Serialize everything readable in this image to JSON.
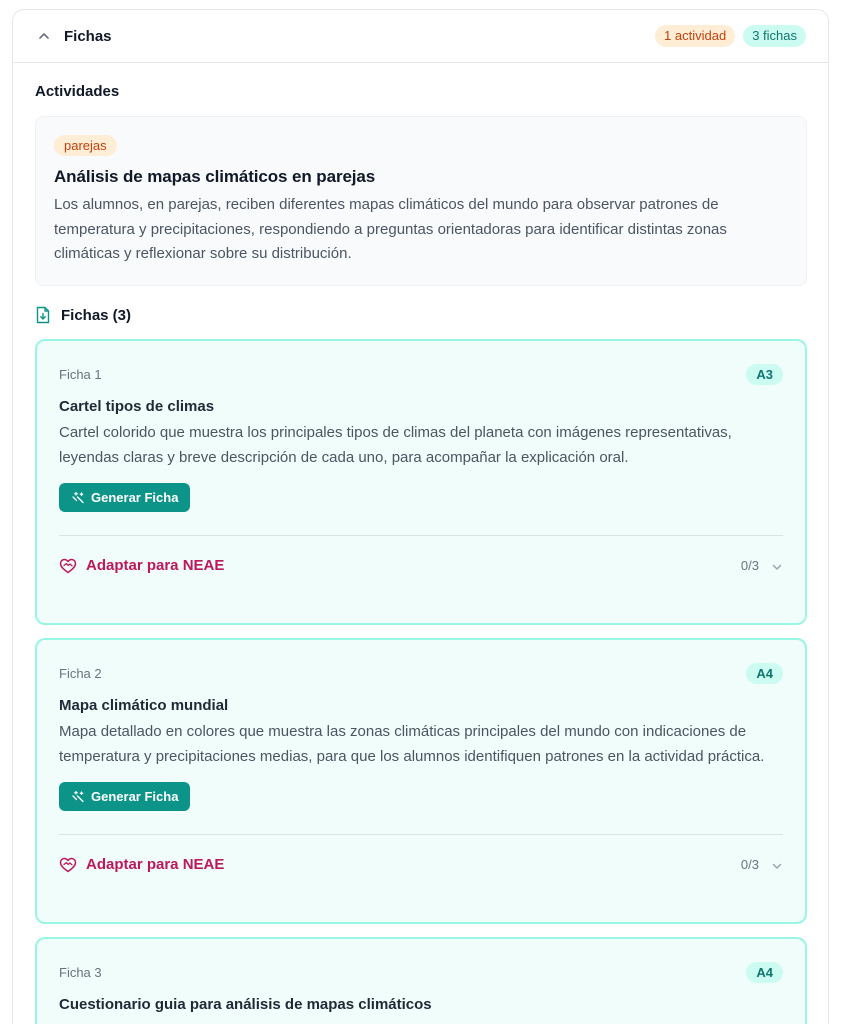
{
  "header": {
    "title": "Fichas",
    "activities_badge": "1 actividad",
    "fichas_badge": "3 fichas"
  },
  "activities": {
    "section_title": "Actividades",
    "items": [
      {
        "tag": "parejas",
        "title": "Análisis de mapas climáticos en parejas",
        "description": "Los alumnos, en parejas, reciben diferentes mapas climáticos del mundo para observar patrones de temperatura y precipitaciones, respondiendo a preguntas orientadoras para identificar distintas zonas climáticas y reflexionar sobre su distribución."
      }
    ]
  },
  "fichas": {
    "heading": "Fichas (3)",
    "items": [
      {
        "number": "Ficha 1",
        "size": "A3",
        "title": "Cartel tipos de climas",
        "description": "Cartel colorido que muestra los principales tipos de climas del planeta con imágenes representativas, leyendas claras y breve descripción de cada uno, para acompañar la explicación oral.",
        "generate_label": "Generar Ficha",
        "neae_label": "Adaptar para NEAE",
        "neae_count": "0/3"
      },
      {
        "number": "Ficha 2",
        "size": "A4",
        "title": "Mapa climático mundial",
        "description": "Mapa detallado en colores que muestra las zonas climáticas principales del mundo con indicaciones de temperatura y precipitaciones medias, para que los alumnos identifiquen patrones en la actividad práctica.",
        "generate_label": "Generar Ficha",
        "neae_label": "Adaptar para NEAE",
        "neae_count": "0/3"
      },
      {
        "number": "Ficha 3",
        "size": "A4",
        "title": "Cuestionario guia para análisis de mapas climáticos"
      }
    ]
  },
  "colors": {
    "teal": "#0d9488",
    "card_bg": "#f0fdfa",
    "card_border": "#99f6e4",
    "neae": "#be185d",
    "orange_badge": "#ffedd5"
  },
  "icons": [
    "chevron-up-icon",
    "document-download-icon",
    "sparkles-icon",
    "heart-handshake-icon",
    "chevron-down-icon"
  ]
}
